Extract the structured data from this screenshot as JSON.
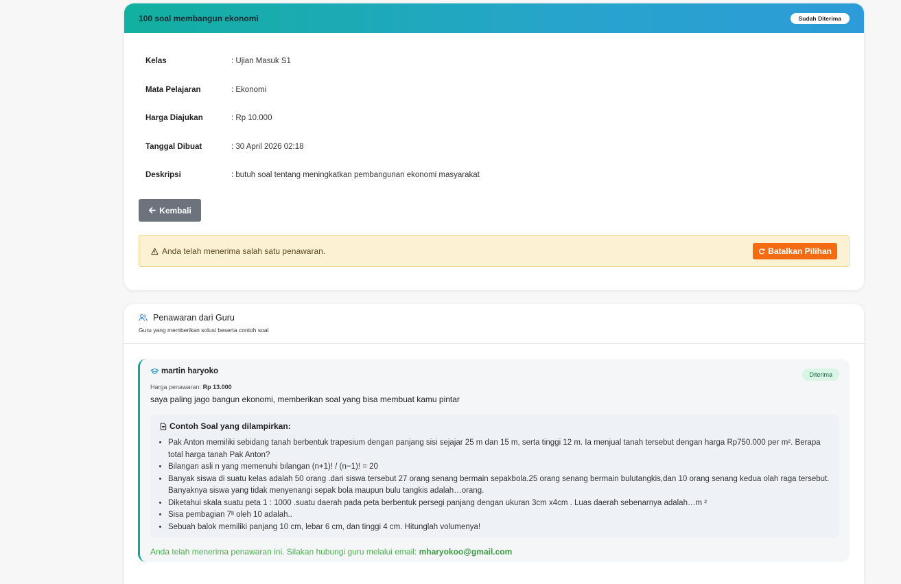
{
  "request": {
    "title": "100 soal membangun ekonomi",
    "status_badge": "Sudah Diterima",
    "fields": [
      {
        "label": "Kelas",
        "value": ": Ujian Masuk S1"
      },
      {
        "label": "Mata Pelajaran",
        "value": ": Ekonomi"
      },
      {
        "label": "Harga Diajukan",
        "value": ": Rp 10.000"
      },
      {
        "label": "Tanggal Dibuat",
        "value": ": 30 April 2026 02:18"
      },
      {
        "label": "Deskripsi",
        "value": ": butuh soal tentang meningkatkan pembangunan ekonomi masyarakat"
      }
    ],
    "back_button": "Kembali",
    "alert_text": "Anda telah menerima salah satu penawaran.",
    "cancel_button": "Batalkan Pilihan"
  },
  "offers": {
    "title": "Penawaran dari Guru",
    "subtitle": "Guru yang memberikan solusi beserta contoh soal",
    "items": [
      {
        "teacher": "martin haryoko",
        "status": "Diterima",
        "price_label": "Harga penawaran:",
        "price": "Rp 13.000",
        "message": "saya paling jago bangun ekonomi, memberikan soal yang bisa membuat kamu pintar",
        "samples_title": "Contoh Soal yang dilampirkan:",
        "samples": [
          "Pak Anton memiliki sebidang tanah berbentuk trapesium dengan panjang sisi sejajar 25 m dan 15 m, serta tinggi 12 m. Ia menjual tanah tersebut dengan harga Rp750.000 per m². Berapa total harga tanah Pak Anton?",
          "Bilangan asli n yang memenuhi bilangan (n+1)! / (n−1)! = 20",
          "Banyak siswa di suatu kelas adalah 50 orang .dari siswa tersebut 27 orang senang bermain sepakbola.25 orang senang bermain bulutangkis,dan 10 orang senang kedua olah raga tersebut. Banyaknya siswa yang tidak menyenangi sepak bola maupun bulu tangkis adalah…orang.",
          "Diketahui skala suatu peta 1 : 1000 .suatu daerah pada peta berbentuk persegi panjang dengan ukuran 3cm x4cm . Luas daerah sebenarnya adalah…m ²",
          "Sisa pembagian 7ᴵᴵ oleh 10 adalah..",
          "Sebuah balok memiliki panjang 10 cm, lebar 6 cm, dan tinggi 4 cm. Hitunglah volumenya!"
        ],
        "contact_text": "Anda telah menerima penawaran ini. Silakan hubungi guru melalui email:",
        "contact_email": "mharyokoo@gmail.com"
      }
    ]
  },
  "colors": {
    "header_gradient_start": "#12b0a0",
    "header_gradient_end": "#2d9bd8",
    "accent_green": "#14a792",
    "cancel_orange": "#f56b12",
    "back_gray": "#6c737d"
  }
}
